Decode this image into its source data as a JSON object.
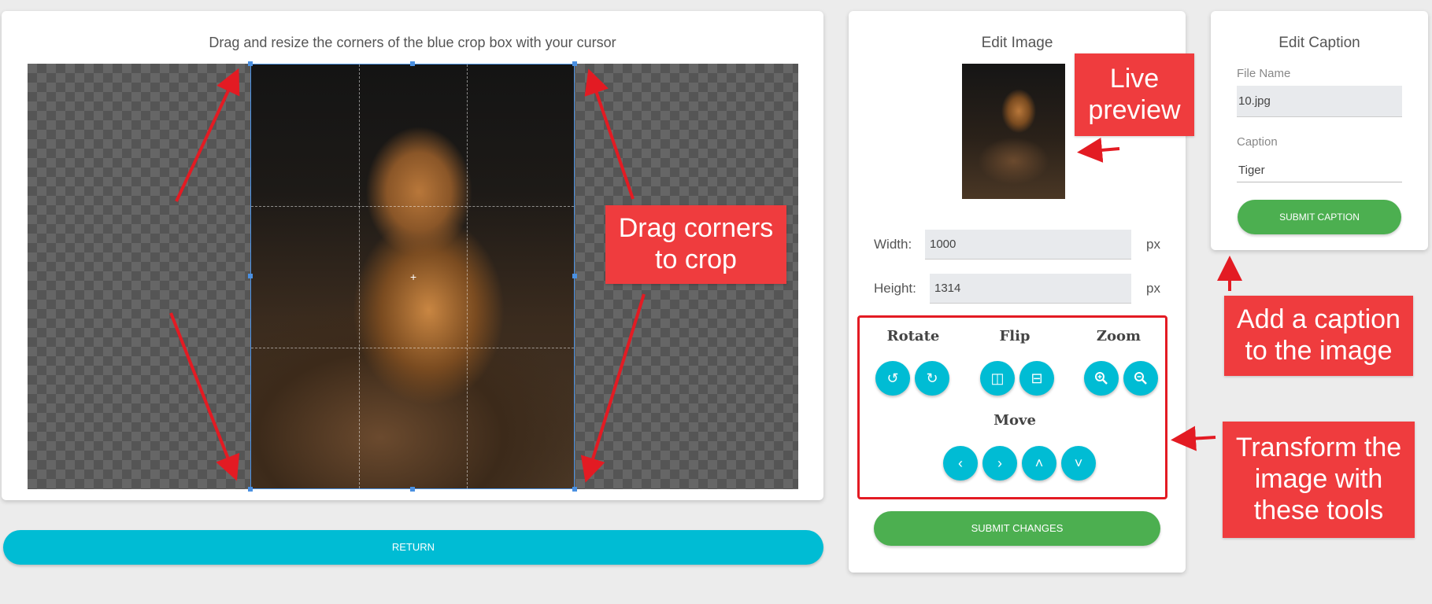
{
  "crop": {
    "instruction": "Drag and resize the corners of the blue crop box with your cursor"
  },
  "return_label": "RETURN",
  "edit": {
    "title": "Edit Image",
    "width_label": "Width:",
    "width_value": "1000",
    "height_label": "Height:",
    "height_value": "1314",
    "unit": "px",
    "rotate_label": "Rotate",
    "flip_label": "Flip",
    "zoom_label": "Zoom",
    "move_label": "Move",
    "submit_label": "SUBMIT CHANGES"
  },
  "caption": {
    "title": "Edit Caption",
    "file_name_label": "File Name",
    "file_name_value": "10.jpg",
    "caption_label": "Caption",
    "caption_value": "Tiger",
    "submit_label": "SUBMIT CAPTION"
  },
  "annotations": {
    "live_preview": "Live\npreview",
    "drag_corners": "Drag corners\nto crop",
    "add_caption": "Add a caption\nto the image",
    "transform": "Transform the\nimage with\nthese tools"
  },
  "icons": {
    "rotate_left": "rotate-left-icon",
    "rotate_right": "rotate-right-icon",
    "flip_horizontal": "flip-horizontal-icon",
    "flip_vertical": "flip-vertical-icon",
    "zoom_in": "zoom-in-icon",
    "zoom_out": "zoom-out-icon",
    "move_left": "chevron-left-icon",
    "move_right": "chevron-right-icon",
    "move_up": "chevron-up-icon",
    "move_down": "chevron-down-icon"
  },
  "colors": {
    "accent_cyan": "#00bcd4",
    "accent_green": "#4caf50",
    "annotation_red": "#ef3c3e",
    "crop_blue": "#4a90e2"
  }
}
